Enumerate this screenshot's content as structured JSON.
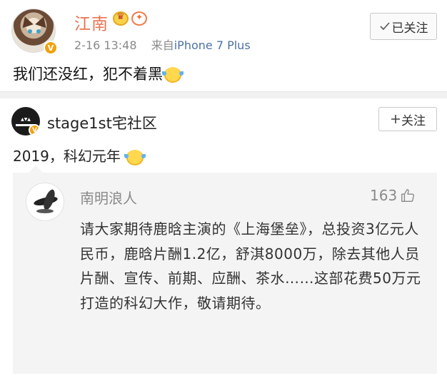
{
  "post1": {
    "username": "江南",
    "timestamp": "2-16 13:48",
    "source_prefix": "来自",
    "device": "iPhone 7 Plus",
    "follow_button": "已关注",
    "content": "我们还没红，犯不着黑",
    "name_color": "#eb7350"
  },
  "post2": {
    "username": "stage1st宅社区",
    "follow_button": "关注",
    "content": "2019，科幻元年"
  },
  "reply": {
    "username": "南明浪人",
    "likes": "163",
    "content": "请大家期待鹿晗主演的《上海堡垒》，总投资3亿元人民币，鹿晗片酬1.2亿，舒淇8000万，除去其他人员片酬、宣传、前期、应酬、茶水……这部花费50万元打造的科幻大作，敬请期待。"
  },
  "icons": {
    "verified": "verified-badge-icon",
    "crown": "crown-icon",
    "fire": "fire-icon",
    "check": "check-icon",
    "plus": "plus-icon",
    "emoji": "laugh-cry-emoji-icon",
    "thumb": "thumbs-up-icon"
  }
}
